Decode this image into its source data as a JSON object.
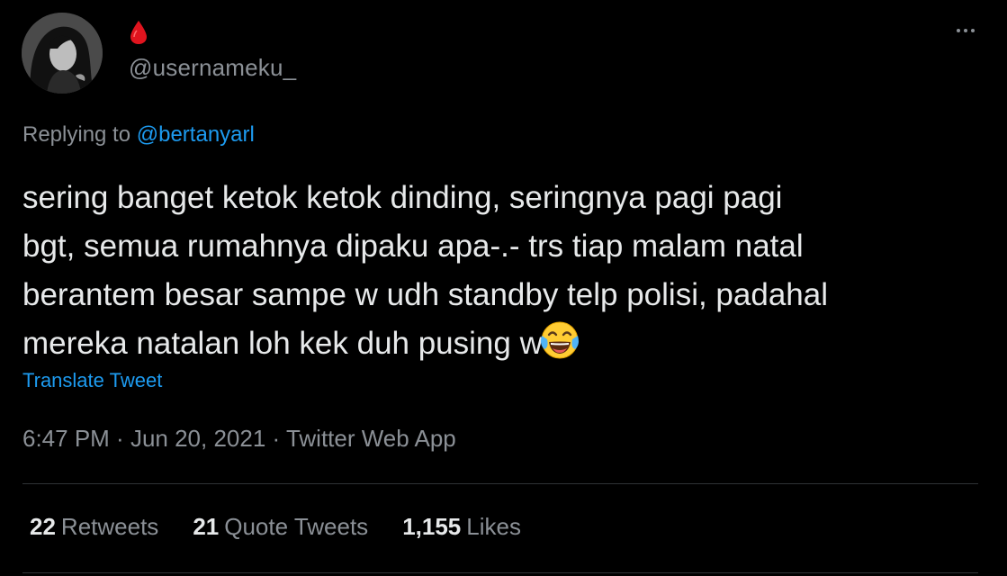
{
  "user": {
    "avatar_icon": "profile-photo",
    "name_icon": "blood-drop-icon",
    "name_icon_color": "#e0141e",
    "handle": "@usernameku_"
  },
  "menu": {
    "icon": "more-horizontal-icon"
  },
  "reply": {
    "prefix": "Replying to ",
    "mention": "@bertanyarl"
  },
  "tweet": {
    "text": "sering banget ketok ketok dinding, seringnya pagi pagi\nbgt, semua rumahnya dipaku apa-.- trs tiap malam natal\nberantem besar sampe w udh standby telp polisi, padahal\nmereka natalan loh kek duh pusing w",
    "emoji_icon": "face-with-tears-of-joy-icon"
  },
  "translate_label": "Translate Tweet",
  "meta": {
    "time": "6:47 PM",
    "separator": " · ",
    "date": "Jun 20, 2021",
    "source": "Twitter Web App"
  },
  "stats": [
    {
      "count": "22",
      "label": "Retweets"
    },
    {
      "count": "21",
      "label": "Quote Tweets"
    },
    {
      "count": "1,155",
      "label": "Likes"
    }
  ],
  "colors": {
    "background": "#000000",
    "link": "#1d9bf0",
    "secondary_text": "#8b9096",
    "primary_text": "#e7e9ea",
    "divider": "#2f3336"
  }
}
